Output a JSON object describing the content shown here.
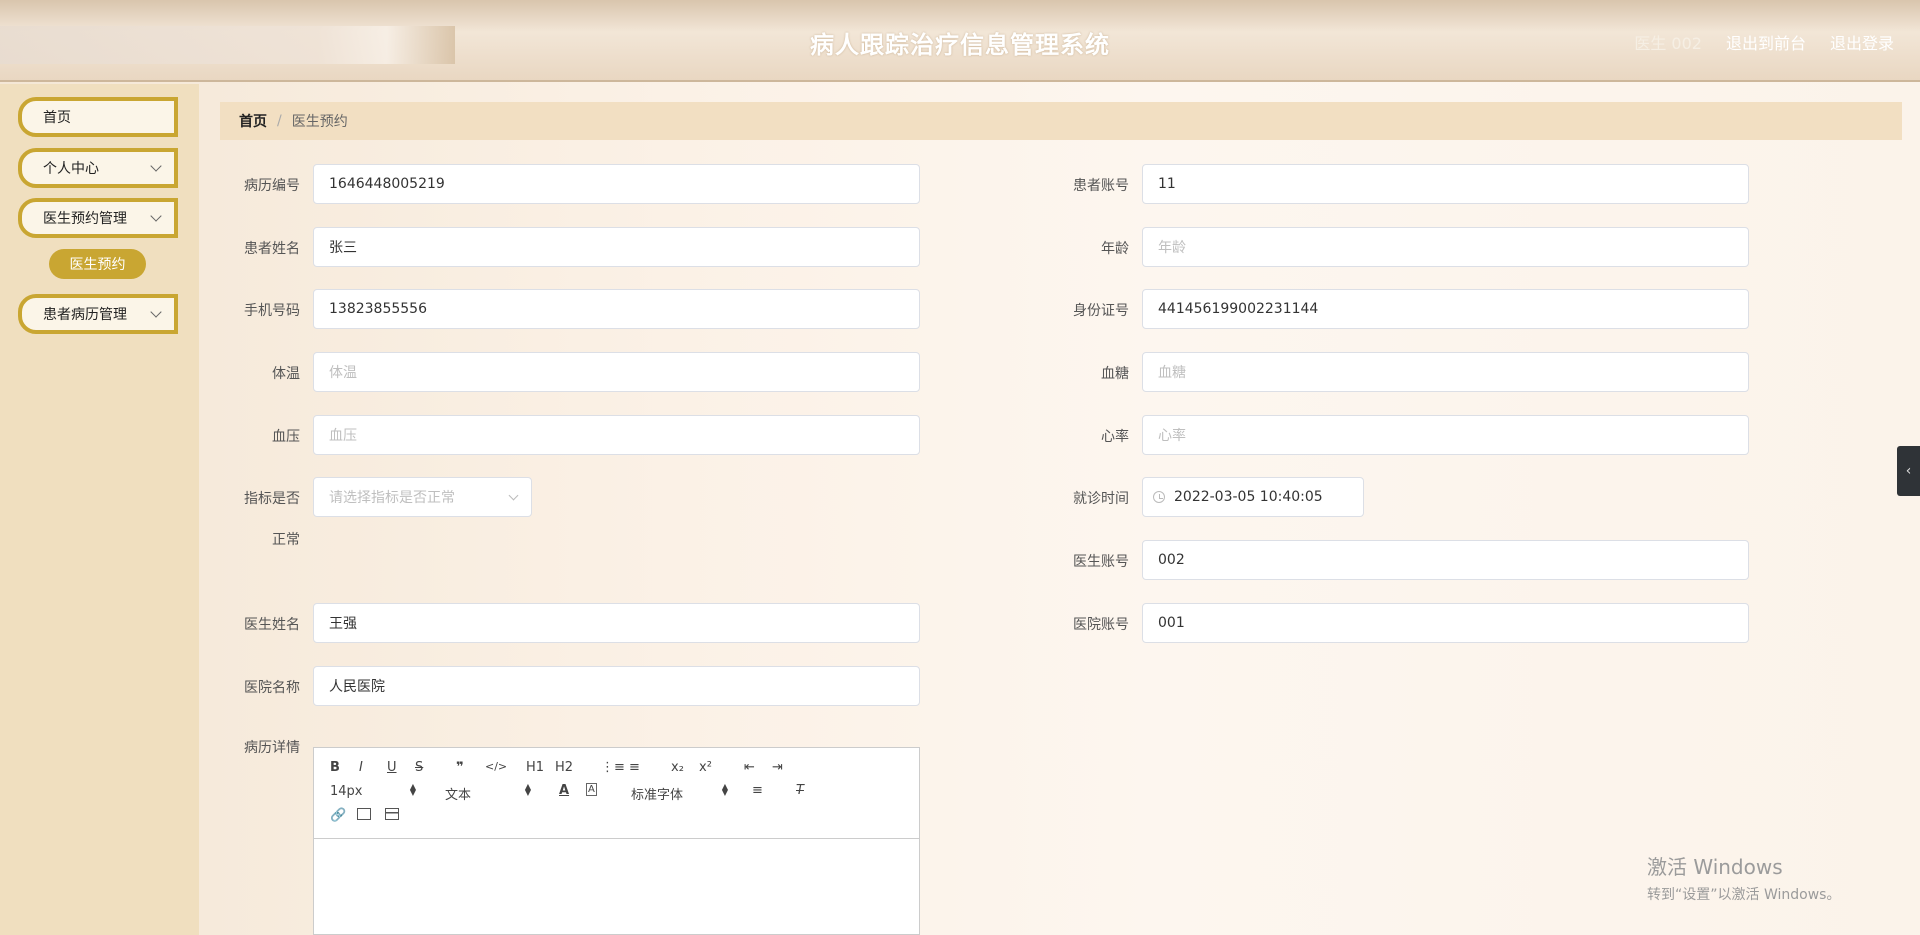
{
  "header": {
    "title": "病人跟踪治疗信息管理系统",
    "user": "医生 002",
    "to_front": "退出到前台",
    "logout": "退出登录"
  },
  "sidebar": {
    "items": [
      {
        "label": "首页"
      },
      {
        "label": "个人中心"
      },
      {
        "label": "医生预约管理"
      },
      {
        "label": "患者病历管理"
      }
    ],
    "sub_active": "医生预约"
  },
  "breadcrumb": {
    "home": "首页",
    "separator": "/",
    "current": "医生预约"
  },
  "form": {
    "record_no": {
      "label": "病历编号",
      "value": "1646448005219"
    },
    "patient_account": {
      "label": "患者账号",
      "value": "11"
    },
    "patient_name": {
      "label": "患者姓名",
      "value": "张三"
    },
    "age": {
      "label": "年龄",
      "placeholder": "年龄"
    },
    "phone": {
      "label": "手机号码",
      "value": "13823855556"
    },
    "id_card": {
      "label": "身份证号",
      "value": "441456199002231144"
    },
    "temperature": {
      "label": "体温",
      "placeholder": "体温"
    },
    "blood_sugar": {
      "label": "血糖",
      "placeholder": "血糖"
    },
    "blood_pressure": {
      "label": "血压",
      "placeholder": "血压"
    },
    "heart_rate": {
      "label": "心率",
      "placeholder": "心率"
    },
    "indicator_normal": {
      "label_line1": "指标是否",
      "label_line2": "正常",
      "placeholder": "请选择指标是否正常"
    },
    "visit_time": {
      "label": "就诊时间",
      "value": "2022-03-05 10:40:05"
    },
    "doctor_account": {
      "label": "医生账号",
      "value": "002"
    },
    "doctor_name": {
      "label": "医生姓名",
      "value": "王强"
    },
    "hospital_account": {
      "label": "医院账号",
      "value": "001"
    },
    "hospital_name": {
      "label": "医院名称",
      "value": "人民医院"
    },
    "record_detail": {
      "label": "病历详情"
    }
  },
  "editor": {
    "buttons": [
      "B",
      "I",
      "U",
      "S",
      "❞",
      "</>",
      "H1",
      "H2",
      "⋮≡",
      "≡",
      "x₂",
      "x²",
      "⇤",
      "⇥"
    ],
    "font_size": "14px",
    "paragraph": "文本",
    "font_family": "标准字体"
  },
  "watermark": {
    "line1": "激活 Windows",
    "line2": "转到“设置”以激活 Windows。"
  }
}
